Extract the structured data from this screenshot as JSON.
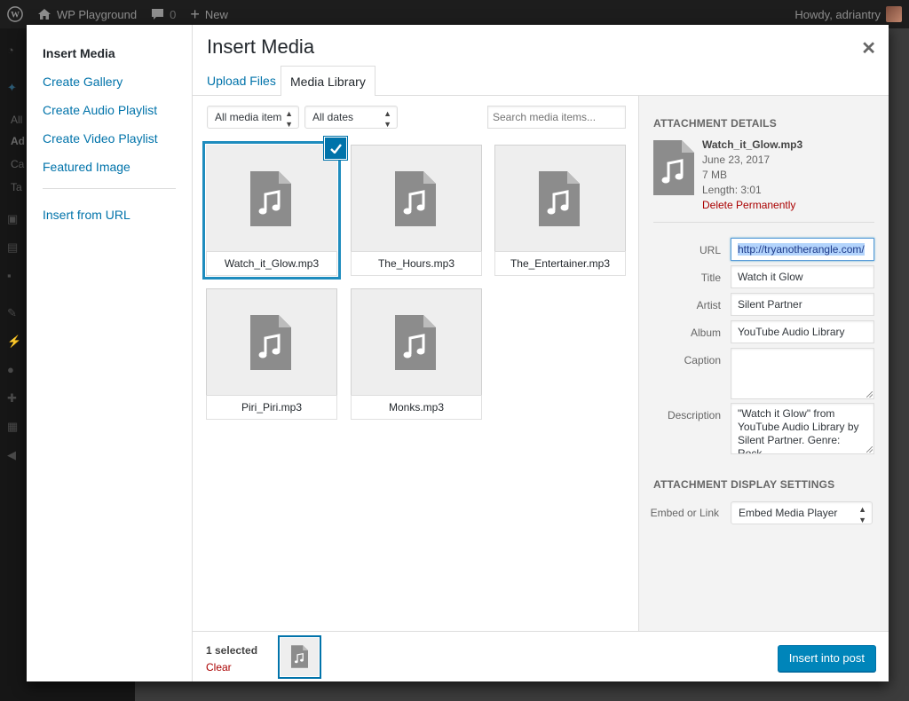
{
  "admin_bar": {
    "site_name": "WP Playground",
    "comments_count": "0",
    "new_label": "New",
    "howdy": "Howdy, adriantry"
  },
  "admin_menu": {
    "partial_labels": [
      "All",
      "Ad",
      "Ca",
      "Ta"
    ]
  },
  "modal": {
    "title": "Insert Media",
    "close_icon": "close-icon",
    "menu": {
      "items": [
        {
          "label": "Insert Media",
          "active": true
        },
        {
          "label": "Create Gallery",
          "active": false
        },
        {
          "label": "Create Audio Playlist",
          "active": false
        },
        {
          "label": "Create Video Playlist",
          "active": false
        },
        {
          "label": "Featured Image",
          "active": false
        }
      ],
      "insert_from_url": "Insert from URL"
    },
    "tabs": [
      {
        "label": "Upload Files",
        "active": false
      },
      {
        "label": "Media Library",
        "active": true
      }
    ],
    "filters": {
      "media_type": "All media item",
      "dates": "All dates",
      "search_placeholder": "Search media items..."
    },
    "attachments": [
      {
        "filename": "Watch_it_Glow.mp3",
        "selected": true
      },
      {
        "filename": "The_Hours.mp3",
        "selected": false
      },
      {
        "filename": "The_Entertainer.mp3",
        "selected": false
      },
      {
        "filename": "Piri_Piri.mp3",
        "selected": false
      },
      {
        "filename": "Monks.mp3",
        "selected": false
      }
    ],
    "details": {
      "heading": "Attachment Details",
      "filename": "Watch_it_Glow.mp3",
      "date": "June 23, 2017",
      "size": "7 MB",
      "length": "Length: 3:01",
      "delete_label": "Delete Permanently",
      "fields": {
        "url_label": "URL",
        "url_value": "http://tryanotherangle.com/",
        "title_label": "Title",
        "title_value": "Watch it Glow",
        "artist_label": "Artist",
        "artist_value": "Silent Partner",
        "album_label": "Album",
        "album_value": "YouTube Audio Library",
        "caption_label": "Caption",
        "caption_value": "",
        "description_label": "Description",
        "description_value": "\"Watch it Glow\" from YouTube Audio Library by Silent Partner. Genre: Rock."
      },
      "display_heading": "Attachment Display Settings",
      "embed_label": "Embed or Link",
      "embed_value": "Embed Media Player"
    },
    "toolbar": {
      "selected_count": "1 selected",
      "clear_label": "Clear",
      "insert_label": "Insert into post"
    }
  },
  "colors": {
    "link": "#0073aa",
    "primary_button": "#0085ba",
    "delete": "#a00",
    "selection": "#1e8cbe"
  }
}
